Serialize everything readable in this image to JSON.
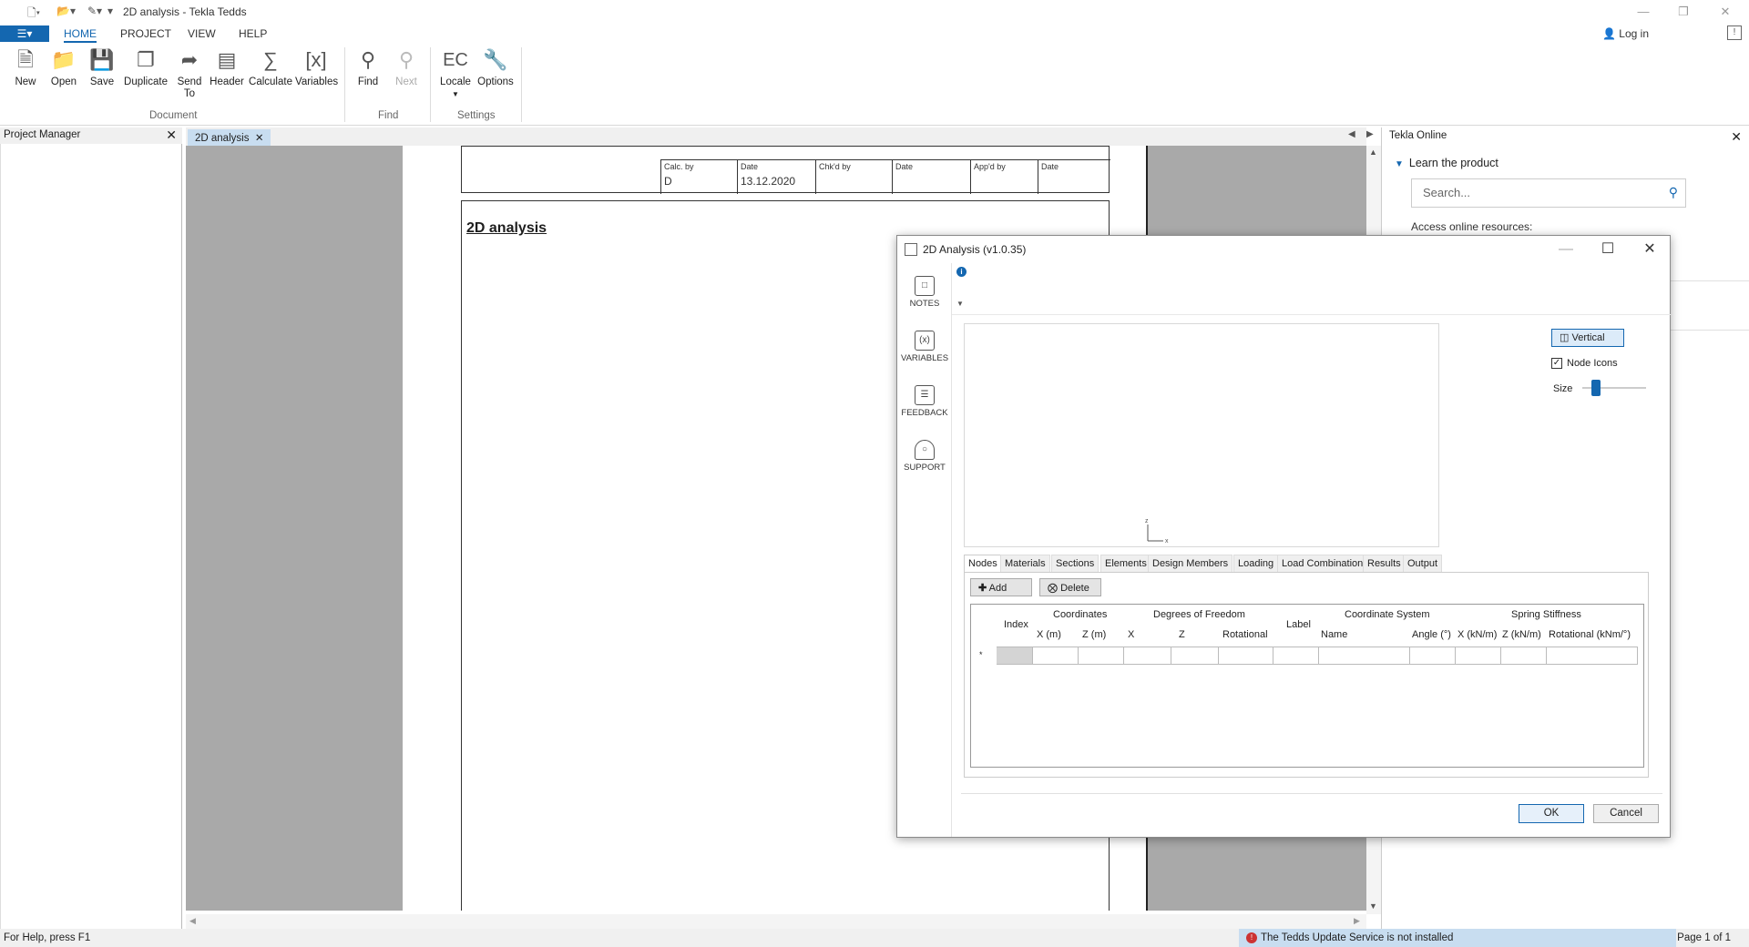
{
  "window": {
    "title": "2D analysis - Tekla Tedds",
    "quick_access": [
      "new-doc",
      "open",
      "save",
      "dropdown"
    ]
  },
  "ribbon_tabs": {
    "file": "",
    "home": "HOME",
    "project": "PROJECT",
    "view": "VIEW",
    "help": "HELP",
    "login": "Log in"
  },
  "ribbon": {
    "document": {
      "label": "Document",
      "new": "New",
      "open": "Open",
      "save": "Save",
      "duplicate": "Duplicate",
      "send_to": "Send\nTo",
      "header": "Header",
      "calculate": "Calculate",
      "variables": "Variables"
    },
    "find": {
      "label": "Find",
      "find": "Find",
      "next": "Next"
    },
    "settings": {
      "label": "Settings",
      "locale": "Locale",
      "locale_icon_text": "EC",
      "options": "Options"
    }
  },
  "project_manager": {
    "title": "Project Manager"
  },
  "doc_tab": {
    "label": "2D analysis"
  },
  "page": {
    "calc_by_label": "Calc. by",
    "calc_by_value": "D",
    "date_label": "Date",
    "date_value": "13.12.2020",
    "chkd_by_label": "Chk'd by",
    "date2_label": "Date",
    "appd_by_label": "App'd by",
    "date3_label": "Date",
    "title": "2D analysis"
  },
  "tekla_online": {
    "title": "Tekla Online",
    "learn": "Learn the product",
    "search_placeholder": "Search...",
    "access": "Access online resources:"
  },
  "status": {
    "help": "For Help, press F1",
    "service": "The Tedds Update Service is not installed",
    "page": "Page 1 of 1"
  },
  "dialog": {
    "title": "2D Analysis (v1.0.35)",
    "sidebar": {
      "notes": "NOTES",
      "variables": "VARIABLES",
      "feedback": "FEEDBACK",
      "support": "SUPPORT"
    },
    "vertical_button": "Vertical",
    "node_icons_label": "Node Icons",
    "node_icons_checked": true,
    "size_label": "Size",
    "size_level": 0.2,
    "tabs": [
      "Nodes",
      "Materials",
      "Sections",
      "Elements",
      "Design Members",
      "Loading",
      "Load Combinations",
      "Results",
      "Output"
    ],
    "active_tab": "Nodes",
    "add_button": "Add",
    "delete_button": "Delete",
    "grid": {
      "index": "Index",
      "coordinates": "Coordinates",
      "x_m": "X (m)",
      "z_m": "Z (m)",
      "degrees_of_freedom": "Degrees of Freedom",
      "dof_x": "X",
      "dof_z": "Z",
      "rotational": "Rotational",
      "label": "Label",
      "coordinate_system": "Coordinate System",
      "name": "Name",
      "angle": "Angle (°)",
      "spring_stiffness": "Spring Stiffness",
      "x_knm": "X (kN/m)",
      "z_knm": "Z (kN/m)",
      "rot_knm": "Rotational (kNm/°)",
      "new_row_marker": "*"
    },
    "ok": "OK",
    "cancel": "Cancel"
  }
}
